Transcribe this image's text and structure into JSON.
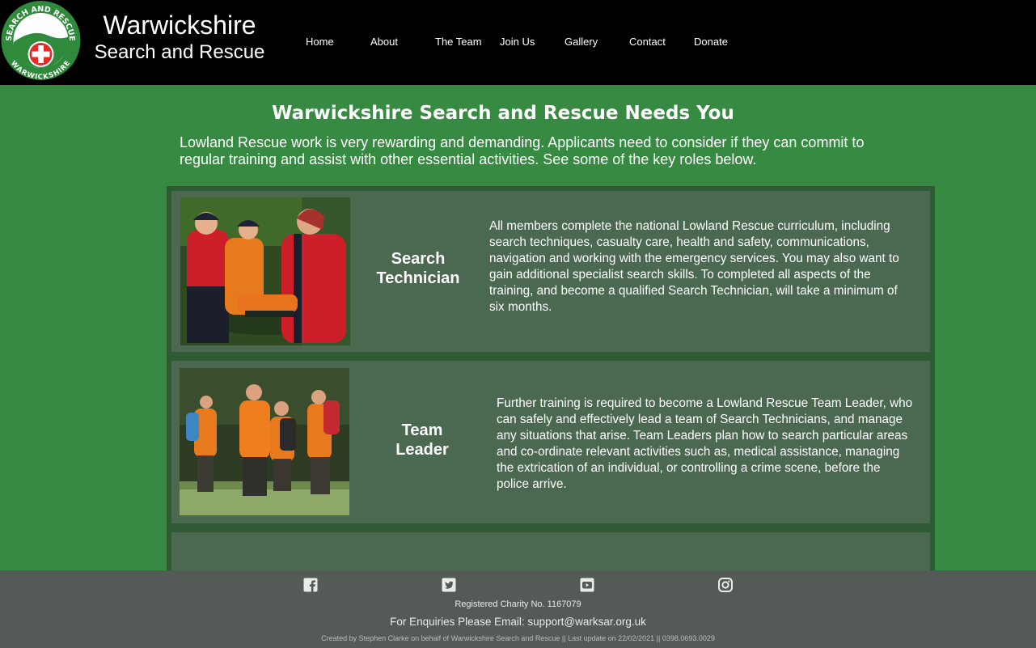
{
  "header": {
    "title_line1": "Warwickshire",
    "title_line2": "Search and Rescue",
    "logo_text_top": "SEARCH AND RESCUE",
    "logo_text_bottom": "WARWICKSHIRE"
  },
  "nav": {
    "items": [
      {
        "label": "Home"
      },
      {
        "label": "About"
      },
      {
        "label": "The Team"
      },
      {
        "label": "Join Us"
      },
      {
        "label": "Gallery"
      },
      {
        "label": "Contact"
      },
      {
        "label": "Donate"
      }
    ]
  },
  "main": {
    "title": "Warwickshire Search and Rescue Needs You",
    "intro": "Lowland Rescue work is very rewarding and demanding. Applicants need to consider if they can commit to regular training and assist with other essential activities. See some of the key roles below.",
    "roles": [
      {
        "name_line1": "Search",
        "name_line2": "Technician",
        "description": "All members complete the national Lowland Rescue curriculum, including search techniques, casualty care, health and safety, communications, navigation and working with the emergency services. You may also want to gain additional specialist search skills.  To completed all aspects of the training, and become a qualified Search Technician, will take a minimum of six months."
      },
      {
        "name_line1": "Team",
        "name_line2": "Leader",
        "description": "Further training is required to become a Lowland Rescue Team Leader, who can safely and effectively lead a team of Search Technicians, and manage any situations that arise.  Team Leaders plan how to search particular areas and co-ordinate relevant activities such as, medical assistance, managing the extrication of an individual, or controlling a crime scene, before the police arrive."
      }
    ]
  },
  "footer": {
    "social_icons": [
      "facebook-icon",
      "twitter-icon",
      "youtube-icon",
      "instagram-icon"
    ],
    "charity": "Registered Charity No. 1167079",
    "enquiries": "For Enquiries Please Email: support@warksar.org.uk",
    "credits": "Created by Stephen Clarke on behalf of Warwickshire Search and Rescue || Last update on 22/02/2021 || 0398.0693.0029"
  },
  "colors": {
    "page_green": "#378a42",
    "card_green": "#4b6850",
    "header_black": "#000000",
    "footer_grey": "#545a56"
  }
}
